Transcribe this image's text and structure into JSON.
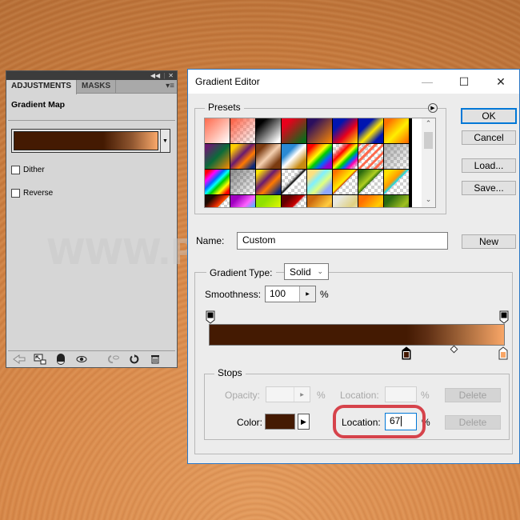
{
  "adjustments_panel": {
    "tabs": [
      {
        "label": "ADJUSTMENTS",
        "active": true
      },
      {
        "label": "MASKS",
        "active": false
      }
    ],
    "topbar_icons": [
      "collapse-icon",
      "close-icon"
    ],
    "title": "Gradient Map",
    "gradient_colors": [
      "#441a02",
      "#f9a86a"
    ],
    "dither_label": "Dither",
    "dither_checked": false,
    "reverse_label": "Reverse",
    "reverse_checked": false,
    "footer_icons": [
      "back-arrow-icon",
      "clip-to-layer-icon",
      "mask-icon",
      "visibility-eye-icon",
      "previous-state-icon",
      "reset-icon",
      "trash-icon"
    ]
  },
  "gradient_editor": {
    "title": "Gradient Editor",
    "window_controls": [
      "minimize",
      "maximize",
      "close"
    ],
    "presets_label": "Presets",
    "buttons": {
      "ok": "OK",
      "cancel": "Cancel",
      "load": "Load...",
      "save": "Save...",
      "new": "New",
      "delete_opacity": "Delete",
      "delete_color": "Delete"
    },
    "name_label": "Name:",
    "name_value": "Custom",
    "gradient_type_label": "Gradient Type:",
    "gradient_type_value": "Solid",
    "smoothness_label": "Smoothness:",
    "smoothness_value": "100",
    "percent": "%",
    "gradient": {
      "color_stops": [
        {
          "color": "#441a02",
          "location": 67,
          "selected": true
        },
        {
          "color": "#f8a667",
          "location": 100,
          "selected": false
        }
      ],
      "opacity_stops": [
        {
          "opacity": 100,
          "location": 0
        },
        {
          "opacity": 100,
          "location": 100
        }
      ],
      "midpoint_location": 83
    },
    "stops": {
      "label": "Stops",
      "opacity_label": "Opacity:",
      "opacity_value": "",
      "opacity_location_label": "Location:",
      "opacity_location_value": "",
      "color_label": "Color:",
      "color_value": "#441a02",
      "color_location_label": "Location:",
      "color_location_value": "67"
    }
  },
  "watermark": "WWW.PSD-DUDE.COM",
  "presets": [
    "linear-gradient(135deg,#ff6a4d 0%,#ffb3a3 50%,#fff 100%)",
    "checker:linear-gradient(135deg,#ff5a3c 0%,rgba(255,120,100,0.5) 55%,rgba(255,255,255,0) 100%)",
    "linear-gradient(135deg,#000 20%,#fff 90%)",
    "linear-gradient(135deg,#e8001c 20%,#0a6b1a 90%)",
    "linear-gradient(135deg,#2b0f5e 20%,#ff8a00 100%)",
    "linear-gradient(135deg,#0015b0 25%,#e8001c 60%,#ffea00 100%)",
    "linear-gradient(135deg,#0015b0 30%,#ffe800 55%,#0015b0 80%)",
    "linear-gradient(135deg,#ff7000 15%,#ffee00 55%,#ff7000 95%)",
    "linear-gradient(135deg,#6a1a70 10%,#0a6b3a 50%,#ff8a00 100%)",
    "linear-gradient(135deg,#ffcc00 15%,#6a1a70 45%,#ff7a00 65%,#102a7a 90%)",
    "linear-gradient(135deg,#7a3a10 20%,#f5d0b0 50%,#7a3a10 80%)",
    "linear-gradient(135deg,#2a8ad4 30%,#fff 50%,#c88a10 80%)",
    "linear-gradient(135deg,#ff0000 15%,#ff9900 30%,#ffff00 42%,#00cc00 55%,#0066ff 70%,#9900cc 85%)",
    "checker:linear-gradient(135deg,rgba(0,0,0,0) 15%,#ff0000 35%,#ffff00 50%,#00cc00 60%,#0066ff 70%,#ff00aa 80%,rgba(0,0,0,0) 95%)",
    "checker:repeating-linear-gradient(135deg,#ff6a4d 0px,#ff6a4d 3px,rgba(255,255,255,0) 3px,rgba(255,255,255,0) 7px)",
    "checker:linear-gradient(135deg,rgba(120,120,120,0.6) 0%,rgba(255,255,255,0) 100%)",
    "linear-gradient(135deg,#ff0000 10%,#ff00ff 25%,#0066ff 40%,#00ffff 50%,#00cc00 60%,#ffff00 75%,#ff0000 90%)",
    "checker:linear-gradient(135deg,rgba(90,90,90,0.7) 0%,rgba(255,255,255,0) 100%)",
    "linear-gradient(135deg,#ffe600 10%,#6a1a70 40%,#ff7a00 60%,#102a7a 90%)",
    "checker:linear-gradient(135deg,rgba(0,0,0,0) 40%,#000 48%,#fff 52%,rgba(0,0,0,0) 60%)",
    "linear-gradient(135deg,#fde080 20%,#80f0ff 40%,#e0ff80 60%,#90a8ff 80%)",
    "checker:linear-gradient(135deg,#ff7000 10%,#ffee00 45%,#cc3300 50%,rgba(0,0,0,0) 50%)",
    "checker:linear-gradient(135deg,#2a6a10 10%,#b0d020 40%,#2a6a10 50%,rgba(0,0,0,0) 50%)",
    "checker:linear-gradient(135deg,#ffe000 15%,#ff9900 40%,#00e0ff 50%,rgba(0,0,0,0) 50%)",
    "checker:linear-gradient(135deg,#1a0a00 20%,#cc2200 40%,#ff5500 50%,rgba(0,0,0,0) 50%)",
    "linear-gradient(135deg,#a000c0 20%,#ff60ff 50%,#00e0ff 80%)",
    "linear-gradient(135deg,#90e000 30%,#ffff00 90%)",
    "checker:linear-gradient(135deg,#600000 20%,#cc0000 45%,rgba(0,0,0,0) 50%)",
    "linear-gradient(135deg,#cc6a10 20%,#ffcc40 60%,#cc6a10 90%)",
    "linear-gradient(135deg,#e8e8e0 20%,#e0d080 60%,#f0f0e0 90%)",
    "linear-gradient(135deg,#ff7000 20%,#ffcc00 60%,#ff7000 90%)",
    "linear-gradient(135deg,#2a6a10 20%,#a0c020 60%,#2a6a10 90%)"
  ]
}
